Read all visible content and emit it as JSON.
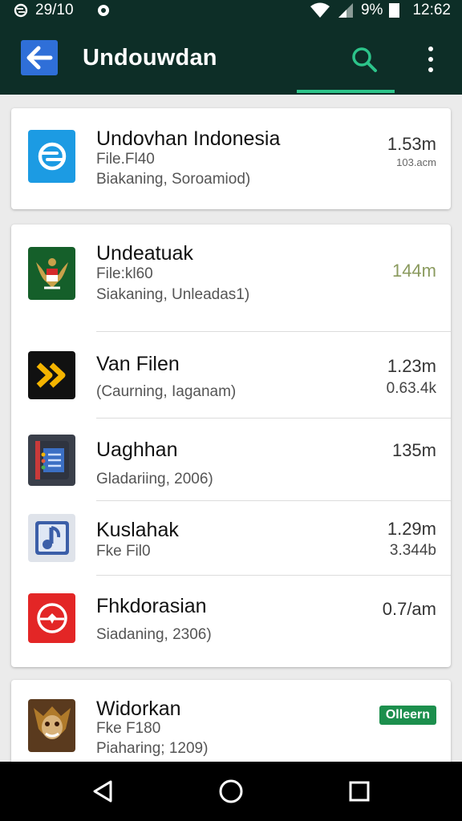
{
  "status_bar": {
    "left_text": "29/10",
    "battery_text": "9%",
    "time": "12:62"
  },
  "app_bar": {
    "title": "Undouwdan",
    "accent_color": "#2cc48a",
    "background_color": "#0d2e27"
  },
  "cards": [
    {
      "items": [
        {
          "name": "Undovhan Indonesia",
          "line1": "File.Fl40",
          "line2": "Biakaning, Soroamiod)",
          "size": "1.53m",
          "size_sub": "103.acm",
          "icon": "sync-arrows-icon"
        }
      ]
    },
    {
      "items": [
        {
          "name": "Undeatuak",
          "line1": "File:kl60",
          "line2": "Siakaning, Unleadas1)",
          "size": "144m",
          "icon": "garuda-emblem-icon"
        },
        {
          "name": "Van Filen",
          "line1": "(Caurning, Iaganam)",
          "size": "1.23m",
          "size_sub": "0.63.4k",
          "icon": "double-chevron-icon"
        },
        {
          "name": "Uaghhan",
          "line1": "Gladariing, 2006)",
          "size": "135m",
          "icon": "notebook-icon"
        },
        {
          "name": "Kuslahak",
          "line1": "Fke Fil0",
          "size": "1.29m",
          "size_sub": "3.344b",
          "icon": "music-note-icon"
        },
        {
          "name": "Fhkdorasian",
          "line1": "Siadaning, 2306)",
          "size": "0.7/am",
          "icon": "airplane-circle-icon"
        }
      ]
    },
    {
      "items": [
        {
          "name": "Widorkan",
          "line1": "Fke F180",
          "line2": "Piaharing; 1209)",
          "badge": "Olleern",
          "icon": "warrior-mask-icon"
        }
      ]
    }
  ],
  "nav_bar": {
    "back": "back-triangle-icon",
    "home": "home-circle-icon",
    "recents": "recents-square-icon"
  }
}
